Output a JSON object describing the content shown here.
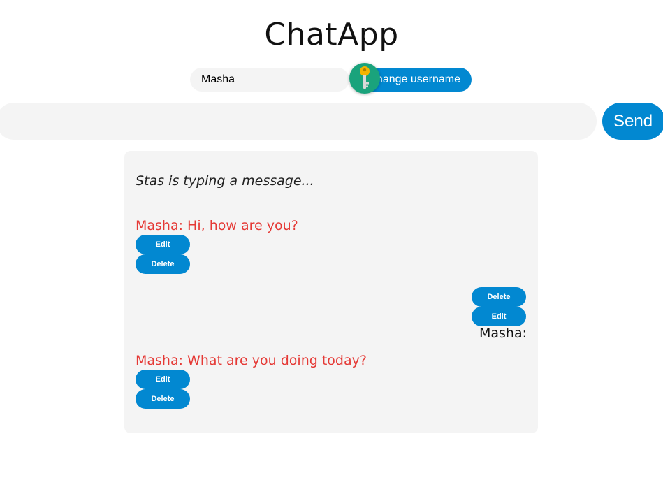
{
  "app": {
    "title": "ChatApp"
  },
  "username": {
    "value": "Masha",
    "change_label": "Change username",
    "badge_icon": "key-icon"
  },
  "composer": {
    "value": "",
    "send_label": "Send"
  },
  "chat": {
    "typing_indicator": "Stas is typing a message...",
    "messages": [
      {
        "text": "Masha: Hi, how are you?",
        "edit_label": "Edit",
        "delete_label": "Delete",
        "color": "#e53935"
      },
      {
        "author": "Masha:",
        "text": "",
        "delete_label": "Delete",
        "edit_label": "Edit",
        "align": "right"
      },
      {
        "text": "Masha: What are you doing today?",
        "edit_label": "Edit",
        "delete_label": "Delete",
        "color": "#e53935"
      }
    ]
  },
  "colors": {
    "accent": "#0288d1",
    "panel_bg": "#f4f4f4",
    "foreign_message": "#e53935",
    "badge": "#1aa37c"
  }
}
